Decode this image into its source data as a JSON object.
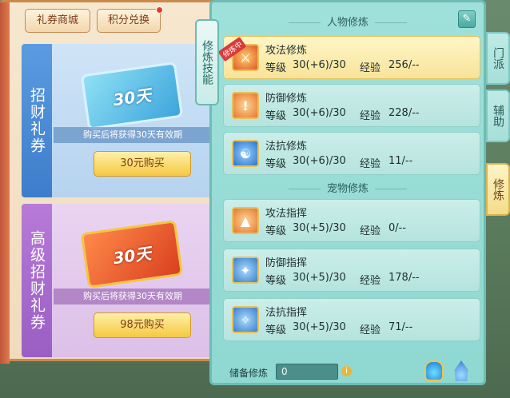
{
  "shop": {
    "tabs": [
      "礼券商城",
      "积分兑换"
    ],
    "cards": [
      {
        "side_label": "招财礼券",
        "ticket_text": "30天",
        "desc": "购买后将获得30天有效期",
        "buy_label": "30元购买"
      },
      {
        "side_label": "高级招财礼券",
        "ticket_text": "30天",
        "desc": "购买后将获得30天有效期",
        "buy_label": "98元购买"
      }
    ]
  },
  "panel": {
    "side_tab": "修炼技能",
    "section_character": "人物修炼",
    "section_pet": "宠物修炼",
    "in_progress_badge": "修炼中",
    "level_label": "等级",
    "exp_label": "经验",
    "character_skills": [
      {
        "name": "攻法修炼",
        "level": "30(+6)/30",
        "exp": "256/--",
        "icon": "attack-magic-icon"
      },
      {
        "name": "防御修炼",
        "level": "30(+6)/30",
        "exp": "228/--",
        "icon": "defense-icon"
      },
      {
        "name": "法抗修炼",
        "level": "30(+6)/30",
        "exp": "11/--",
        "icon": "magic-resist-icon"
      }
    ],
    "pet_skills": [
      {
        "name": "攻法指挥",
        "level": "30(+5)/30",
        "exp": "0/--",
        "icon": "pet-attack-icon"
      },
      {
        "name": "防御指挥",
        "level": "30(+5)/30",
        "exp": "178/--",
        "icon": "pet-defense-icon"
      },
      {
        "name": "法抗指挥",
        "level": "30(+5)/30",
        "exp": "71/--",
        "icon": "pet-resist-icon"
      }
    ],
    "reserve_label": "储备修炼",
    "reserve_value": "0"
  },
  "right_tabs": [
    "门派",
    "辅助",
    "修炼"
  ],
  "colors": {
    "panel_bg": "#9fe1da",
    "active_skill_bg": "#fff6c6",
    "buy_button": "#f5c842"
  }
}
